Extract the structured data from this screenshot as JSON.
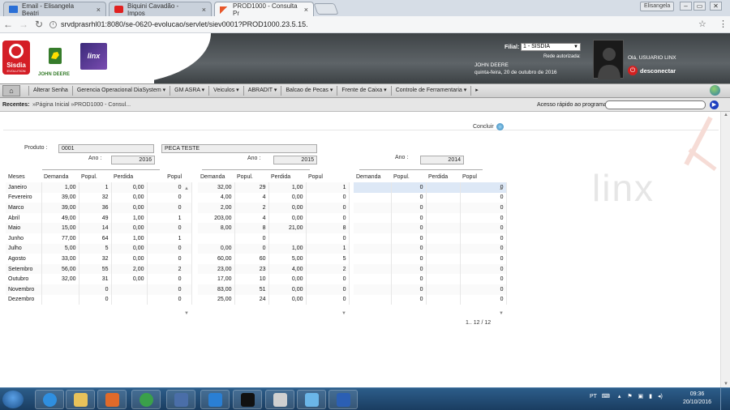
{
  "browser": {
    "tabs": [
      {
        "label": "Email - Elisangela Beatri",
        "icon": "mail-icon",
        "color": "#2a6fd6"
      },
      {
        "label": "Biquini Cavadão - Impos",
        "icon": "youtube-icon",
        "color": "#e02020"
      },
      {
        "label": "PROD1000 - Consulta Pr",
        "icon": "linx-icon",
        "color": "#e8572a",
        "active": true
      }
    ],
    "profile": "Elisangela",
    "url": "srvdprasrhl01:8080/se-0620-evolucao/servlet/siev0001?PROD1000.23.5.15."
  },
  "header": {
    "logos": {
      "sisdia": "Sisdia",
      "sisdia_sub": "EVOLUTION",
      "jd": "JOHN DEERE",
      "linx": "linx"
    },
    "filial_label": "Filial:",
    "filial_value": "1 - SISDIA",
    "rede_label": "Rede autorizada:",
    "rede_name": "JOHN DEERE",
    "date": "quinta-feira, 20 de outubro de 2016",
    "greeting": "Olá, USUARIO LINX",
    "logout": "desconectar"
  },
  "menu": [
    {
      "label": "Alterar Senha",
      "dropdown": false
    },
    {
      "label": "Gerencia Operacional DiaSystem",
      "dropdown": true
    },
    {
      "label": "GM ASRA",
      "dropdown": true
    },
    {
      "label": "Veiculos",
      "dropdown": true
    },
    {
      "label": "ABRADIT",
      "dropdown": true
    },
    {
      "label": "Balcao de Pecas",
      "dropdown": true
    },
    {
      "label": "Frente de Caixa",
      "dropdown": true
    },
    {
      "label": "Controle de Ferramentaria",
      "dropdown": true
    },
    {
      "label": "▸",
      "dropdown": true
    }
  ],
  "recentes": {
    "label": "Recentes:",
    "path": "»Página Inicial »PROD1000 - Consul...",
    "quick_label": "Acesso rápido ao programa:"
  },
  "form": {
    "concluir": "Concluir",
    "produto_label": "Produto :",
    "produto_code": "0001",
    "produto_desc": "PECA TESTE",
    "ano_label": "Ano :",
    "anos": [
      "2016",
      "2015",
      "2014"
    ]
  },
  "grid": {
    "meses_header": "Meses",
    "headers": [
      "Demanda",
      "Popul.",
      "Perdida",
      "Popul"
    ],
    "months": [
      "Janeiro",
      "Fevereiro",
      "Marco",
      "Abril",
      "Maio",
      "Junho",
      "Julho",
      "Agosto",
      "Setembro",
      "Outubro",
      "Novembro",
      "Dezembro"
    ],
    "years": [
      {
        "rows": [
          [
            "1,00",
            "1",
            "0,00",
            "0"
          ],
          [
            "39,00",
            "32",
            "0,00",
            "0"
          ],
          [
            "39,00",
            "36",
            "0,00",
            "0"
          ],
          [
            "49,00",
            "49",
            "1,00",
            "1"
          ],
          [
            "15,00",
            "14",
            "0,00",
            "0"
          ],
          [
            "77,00",
            "64",
            "1,00",
            "1"
          ],
          [
            "5,00",
            "5",
            "0,00",
            "0"
          ],
          [
            "33,00",
            "32",
            "0,00",
            "0"
          ],
          [
            "56,00",
            "55",
            "2,00",
            "2"
          ],
          [
            "32,00",
            "31",
            "0,00",
            "0"
          ],
          [
            "",
            "0",
            "",
            "0"
          ],
          [
            "",
            "0",
            "",
            "0"
          ]
        ]
      },
      {
        "rows": [
          [
            "32,00",
            "29",
            "1,00",
            "1"
          ],
          [
            "4,00",
            "4",
            "0,00",
            "0"
          ],
          [
            "2,00",
            "2",
            "0,00",
            "0"
          ],
          [
            "203,00",
            "4",
            "0,00",
            "0"
          ],
          [
            "8,00",
            "8",
            "21,00",
            "8"
          ],
          [
            "",
            "0",
            "",
            "0"
          ],
          [
            "0,00",
            "0",
            "1,00",
            "1"
          ],
          [
            "60,00",
            "60",
            "5,00",
            "5"
          ],
          [
            "23,00",
            "23",
            "4,00",
            "2"
          ],
          [
            "17,00",
            "10",
            "0,00",
            "0"
          ],
          [
            "83,00",
            "51",
            "0,00",
            "0"
          ],
          [
            "25,00",
            "24",
            "0,00",
            "0"
          ]
        ]
      },
      {
        "rows": [
          [
            "",
            "0",
            "",
            "0"
          ],
          [
            "",
            "0",
            "",
            "0"
          ],
          [
            "",
            "0",
            "",
            "0"
          ],
          [
            "",
            "0",
            "",
            "0"
          ],
          [
            "",
            "0",
            "",
            "0"
          ],
          [
            "",
            "0",
            "",
            "0"
          ],
          [
            "",
            "0",
            "",
            "0"
          ],
          [
            "",
            "0",
            "",
            "0"
          ],
          [
            "",
            "0",
            "",
            "0"
          ],
          [
            "",
            "0",
            "",
            "0"
          ],
          [
            "",
            "0",
            "",
            "0"
          ],
          [
            "",
            "0",
            "",
            "0"
          ]
        ]
      }
    ],
    "pager": "1.. 12 / 12"
  },
  "watermark": "linx",
  "taskbar": {
    "apps": [
      {
        "icon": "ie-icon",
        "color": "#2f8fe0"
      },
      {
        "icon": "explorer-icon",
        "color": "#e8c25a"
      },
      {
        "icon": "media-player-icon",
        "color": "#e06a2a"
      },
      {
        "icon": "chrome-icon",
        "color": "#3aa04a"
      },
      {
        "icon": "remote-desktop-icon",
        "color": "#4a6ea8"
      },
      {
        "icon": "lync-icon",
        "color": "#2a7fd4"
      },
      {
        "icon": "terminal-icon",
        "color": "#111111"
      },
      {
        "icon": "java-icon",
        "color": "#d0d0d0"
      },
      {
        "icon": "notepad-icon",
        "color": "#6bb6e8"
      },
      {
        "icon": "word-icon",
        "color": "#2b5fb4"
      }
    ],
    "lang": "PT",
    "time": "09:36",
    "date": "20/10/2016"
  }
}
